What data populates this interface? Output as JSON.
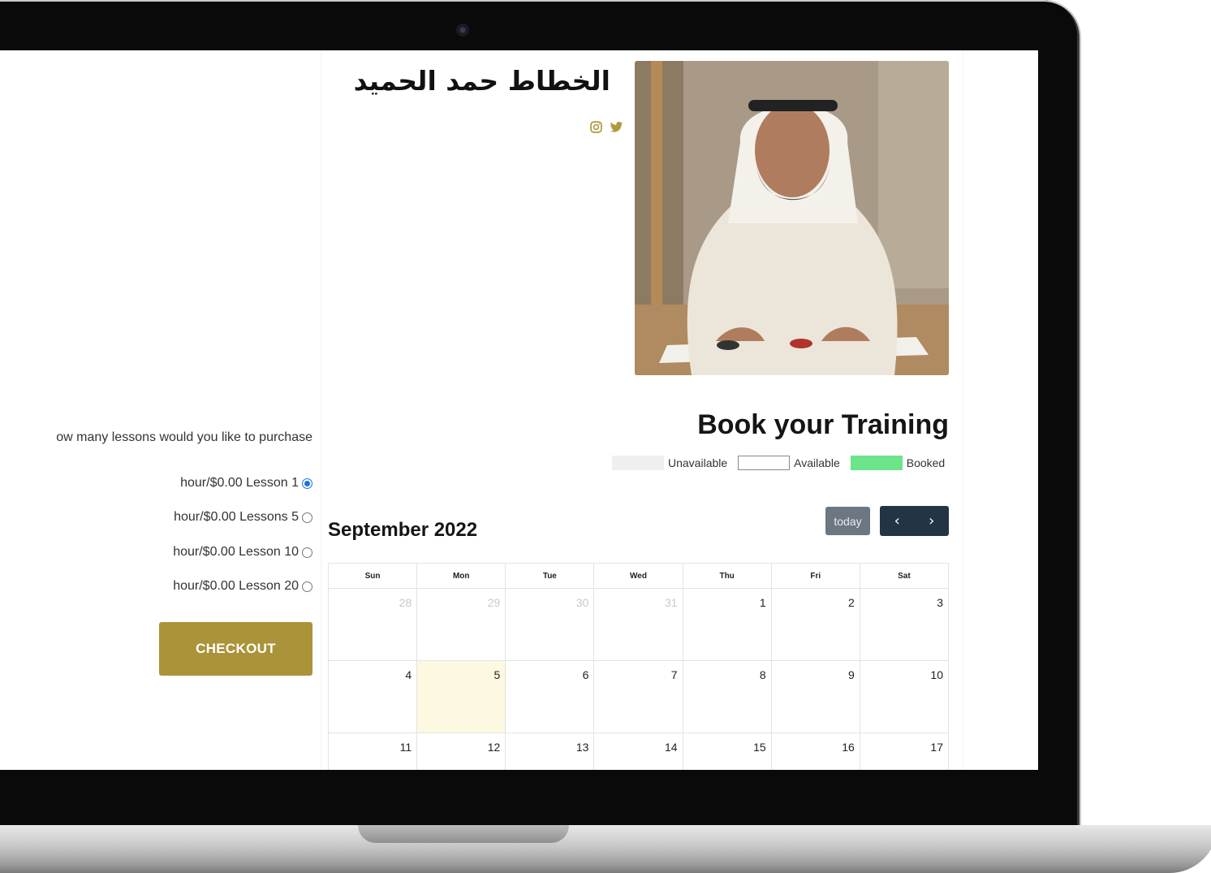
{
  "instructor": {
    "name": "الخطاط حمد الحميد",
    "social": [
      {
        "icon": "instagram-icon"
      },
      {
        "icon": "twitter-icon"
      }
    ],
    "photo_icon": "instructor-photo"
  },
  "booking": {
    "title": "Book your Training",
    "legend": {
      "unavailable": "Unavailable",
      "available": "Available",
      "booked": "Booked"
    }
  },
  "purchase": {
    "question": "ow many lessons would you like to purchase",
    "options": [
      {
        "label": "hour/$0.00 Lesson 1",
        "selected": true
      },
      {
        "label": "hour/$0.00 Lessons 5",
        "selected": false
      },
      {
        "label": "hour/$0.00 Lesson 10",
        "selected": false
      },
      {
        "label": "hour/$0.00 Lesson 20",
        "selected": false
      }
    ],
    "checkout_label": "CHECKOUT"
  },
  "calendar": {
    "title": "September 2022",
    "today_label": "today",
    "prev_label": "‹",
    "next_label": "›",
    "weekdays": [
      "Sun",
      "Mon",
      "Tue",
      "Wed",
      "Thu",
      "Fri",
      "Sat"
    ],
    "weeks": [
      [
        "28",
        "29",
        "30",
        "31",
        "1",
        "2",
        "3"
      ],
      [
        "4",
        "5",
        "6",
        "7",
        "8",
        "9",
        "10"
      ],
      [
        "11",
        "12",
        "13",
        "14",
        "15",
        "16",
        "17"
      ]
    ]
  },
  "colors": {
    "accent_gold": "#ab9339",
    "nav_dark": "#233445",
    "today_button": "#6c7781",
    "booked_green": "#6be48b",
    "today_highlight": "#fdf8e0",
    "radio_blue": "#1a73e8"
  }
}
